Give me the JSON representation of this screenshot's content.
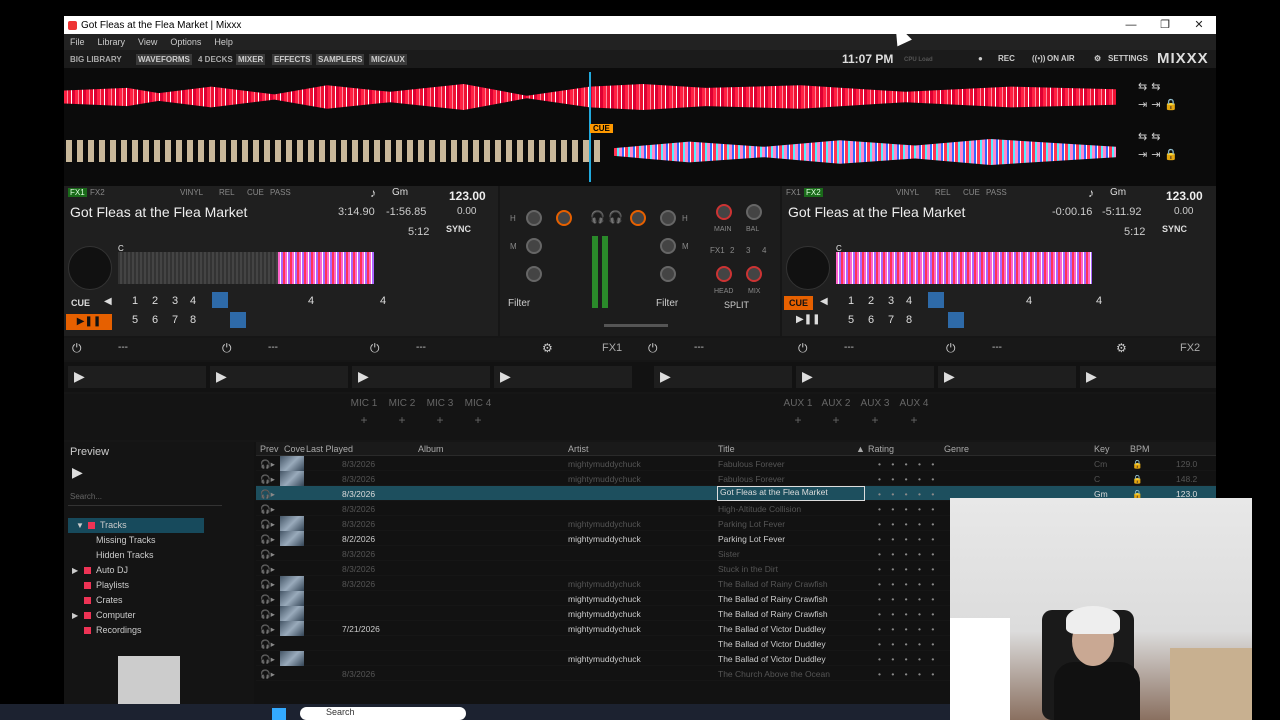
{
  "window": {
    "title": "Got Fleas at the Flea Market | Mixxx",
    "min": "—",
    "max": "❐",
    "close": "✕"
  },
  "menu": [
    "File",
    "Library",
    "View",
    "Options",
    "Help"
  ],
  "topbar": {
    "big_library": "BIG LIBRARY",
    "toggles": [
      "WAVEFORMS",
      "4 DECKS",
      "MIXER",
      "EFFECTS",
      "SAMPLERS",
      "MIC/AUX"
    ],
    "clock": "11:07 PM",
    "cpu": "CPU Load",
    "rec": "REC",
    "on_air": "ON AIR",
    "settings": "SETTINGS",
    "logo": "MIXXX"
  },
  "waveform": {
    "cue_label": "CUE"
  },
  "deck_left": {
    "fx": [
      "FX1",
      "FX2"
    ],
    "opts": [
      "VINYL",
      "REL",
      "CUE",
      "PASS"
    ],
    "key": "Gm",
    "bpm": "123.00",
    "rate": "0.00",
    "title": "Got Fleas at the Flea Market",
    "elapsed": "3:14.90",
    "remain": "-1:56.85",
    "duration": "5:12",
    "sync": "SYNC",
    "cue": "CUE",
    "hotcues": [
      "1",
      "2",
      "3",
      "4",
      "5",
      "6",
      "7",
      "8"
    ],
    "beatloop": "4",
    "beatjump": "4",
    "marker": "C"
  },
  "deck_right": {
    "fx": [
      "FX1",
      "FX2"
    ],
    "opts": [
      "VINYL",
      "REL",
      "CUE",
      "PASS"
    ],
    "key": "Gm",
    "bpm": "123.00",
    "rate": "0.00",
    "title": "Got Fleas at the Flea Market",
    "elapsed": "-0:00.16",
    "remain": "-5:11.92",
    "duration": "5:12",
    "sync": "SYNC",
    "cue": "CUE",
    "hotcues": [
      "1",
      "2",
      "3",
      "4",
      "5",
      "6",
      "7",
      "8"
    ],
    "beatloop": "4",
    "beatjump": "4",
    "marker": "C"
  },
  "mixer": {
    "eq": [
      "H",
      "M",
      "L"
    ],
    "filter_l": "Filter",
    "filter_r": "Filter",
    "main": "MAIN",
    "bal": "BAL",
    "head": "HEAD",
    "mix": "MIX",
    "split": "SPLIT",
    "fx_assign": [
      "FX1",
      "2",
      "3",
      "4"
    ]
  },
  "fx": {
    "unit1": "FX1",
    "unit2": "FX2",
    "slot_placeholder": "---"
  },
  "mics": [
    "MIC 1",
    "MIC 2",
    "MIC 3",
    "MIC 4"
  ],
  "auxes": [
    "AUX 1",
    "AUX 2",
    "AUX 3",
    "AUX 4"
  ],
  "library": {
    "preview_title": "Preview",
    "search_placeholder": "Search...",
    "tree": [
      "Tracks",
      "Missing Tracks",
      "Hidden Tracks",
      "Auto DJ",
      "Playlists",
      "Crates",
      "Computer",
      "Recordings"
    ],
    "columns": [
      "Prev",
      "Cove",
      "Last Played",
      "Album",
      "Artist",
      "Title",
      "Rating",
      "Genre",
      "Key",
      "BPM"
    ],
    "rows": [
      {
        "played": "8/3/2026",
        "artist": "mightymuddychuck",
        "title": "Fabulous Forever",
        "key": "Cm",
        "bpm": "129.0",
        "bright": false,
        "thumb": true
      },
      {
        "played": "8/3/2026",
        "artist": "mightymuddychuck",
        "title": "Fabulous Forever",
        "key": "C",
        "bpm": "148.2",
        "bright": false,
        "thumb": true
      },
      {
        "played": "8/3/2026",
        "artist": "",
        "title": "Got Fleas at the Flea Market",
        "key": "Gm",
        "bpm": "123.0",
        "selected": true,
        "thumb": false
      },
      {
        "played": "8/3/2026",
        "artist": "",
        "title": "High-Altitude Collision",
        "key": "",
        "bpm": "",
        "bright": false,
        "thumb": false
      },
      {
        "played": "8/3/2026",
        "artist": "mightymuddychuck",
        "title": "Parking Lot Fever",
        "key": "",
        "bpm": "",
        "bright": false,
        "thumb": true
      },
      {
        "played": "8/2/2026",
        "artist": "mightymuddychuck",
        "title": "Parking Lot Fever",
        "key": "",
        "bpm": "",
        "bright": true,
        "thumb": true
      },
      {
        "played": "8/3/2026",
        "artist": "",
        "title": "Sister",
        "key": "",
        "bpm": "",
        "bright": false,
        "thumb": false
      },
      {
        "played": "8/3/2026",
        "artist": "",
        "title": "Stuck in the Dirt",
        "key": "",
        "bpm": "",
        "bright": false,
        "thumb": false
      },
      {
        "played": "8/3/2026",
        "artist": "mightymuddychuck",
        "title": "The Ballad of Rainy Crawfish",
        "key": "",
        "bpm": "",
        "bright": false,
        "thumb": true
      },
      {
        "played": "",
        "artist": "mightymuddychuck",
        "title": "The Ballad of Rainy Crawfish",
        "key": "",
        "bpm": "",
        "bright": true,
        "thumb": true
      },
      {
        "played": "",
        "artist": "mightymuddychuck",
        "title": "The Ballad of Rainy Crawfish",
        "key": "",
        "bpm": "",
        "bright": true,
        "thumb": true
      },
      {
        "played": "7/21/2026",
        "artist": "mightymuddychuck",
        "title": "The Ballad of Victor Duddley",
        "key": "",
        "bpm": "",
        "bright": true,
        "thumb": true
      },
      {
        "played": "",
        "artist": "",
        "title": "The Ballad of Victor Duddley",
        "key": "",
        "bpm": "",
        "bright": true,
        "thumb": false
      },
      {
        "played": "",
        "artist": "mightymuddychuck",
        "title": "The Ballad of Victor Duddley",
        "key": "",
        "bpm": "",
        "bright": true,
        "thumb": true
      },
      {
        "played": "8/3/2026",
        "artist": "",
        "title": "The Church Above the Ocean",
        "key": "",
        "bpm": "",
        "bright": false,
        "thumb": false
      }
    ],
    "rating_dots": "• • • • •"
  },
  "taskbar": {
    "search": "Search"
  },
  "colors": {
    "accent": "#e66000",
    "selected_row": "#1d4f5e",
    "waveform": "#ff2244"
  }
}
